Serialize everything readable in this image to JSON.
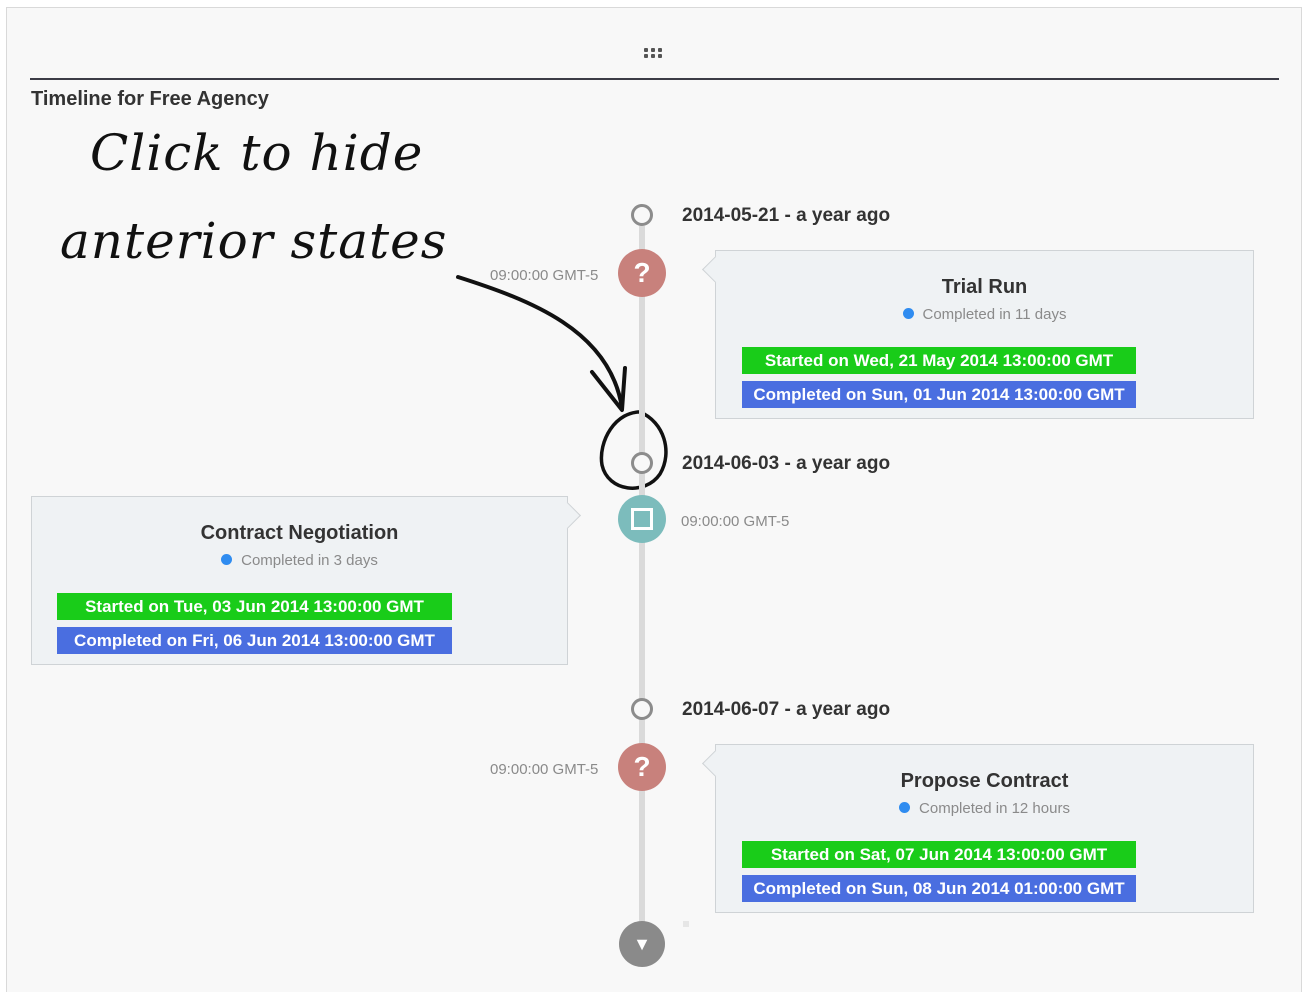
{
  "page_title": "Timeline for Free Agency",
  "annotation": {
    "line1": "Click to hide",
    "line2": "anterior states"
  },
  "icons": {
    "drag": "drag-handle-icon",
    "question": "?",
    "state": "square-icon",
    "more": "▼"
  },
  "timeline": [
    {
      "date": "2014-05-21 - a year ago",
      "time": "09:00:00 GMT-5",
      "title": "Trial Run",
      "status": "Completed in 11 days",
      "started": "Started on Wed, 21 May 2014 13:00:00 GMT",
      "completed": "Completed on Sun, 01 Jun 2014 13:00:00 GMT"
    },
    {
      "date": "2014-06-03 - a year ago",
      "time": "09:00:00 GMT-5",
      "title": "Contract Negotiation",
      "status": "Completed in 3 days",
      "started": "Started on Tue, 03 Jun 2014 13:00:00 GMT",
      "completed": "Completed on Fri, 06 Jun 2014 13:00:00 GMT"
    },
    {
      "date": "2014-06-07 - a year ago",
      "time": "09:00:00 GMT-5",
      "title": "Propose Contract",
      "status": "Completed in 12 hours",
      "started": "Started on Sat, 07 Jun 2014 13:00:00 GMT",
      "completed": "Completed on Sun, 08 Jun 2014 01:00:00 GMT"
    }
  ],
  "colors": {
    "started_bar": "#19cc19",
    "completed_bar": "#4a6ee0",
    "question_node": "#c8817c",
    "square_node": "#7cbcbc",
    "status_dot": "#2f8cf0"
  }
}
